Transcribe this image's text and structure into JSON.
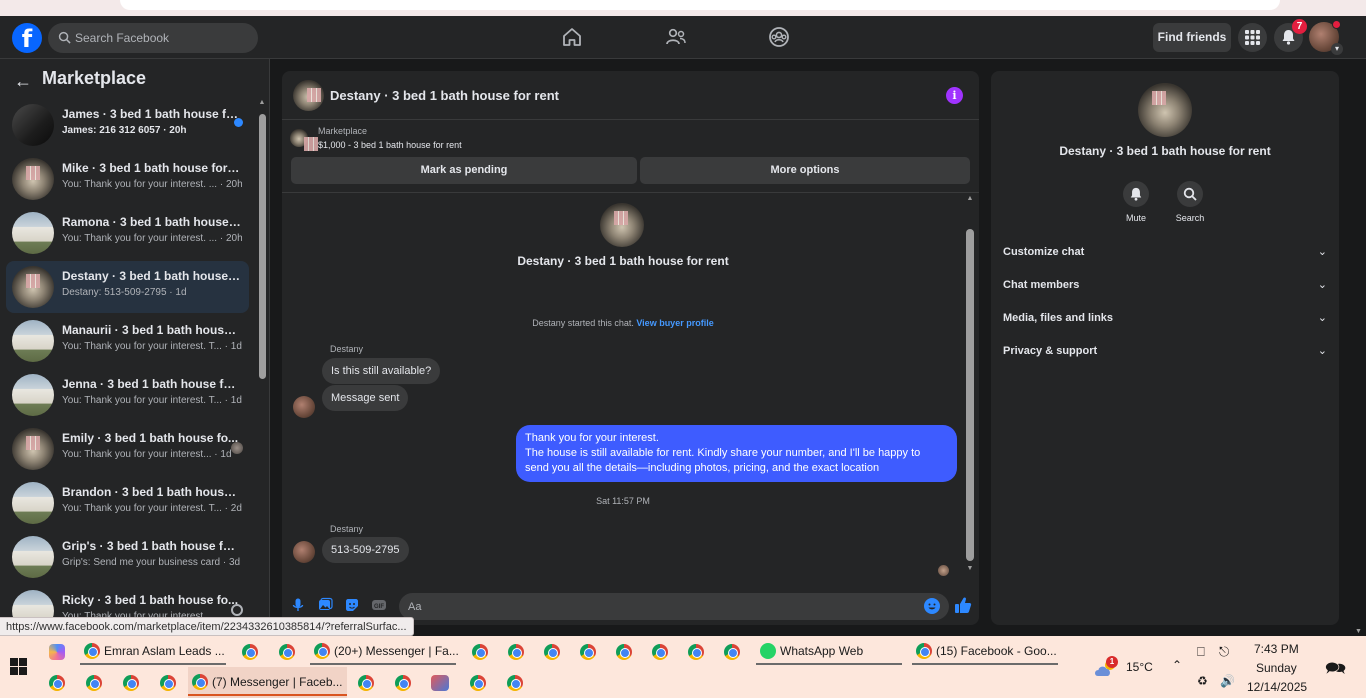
{
  "browser": {
    "status_url": "https://www.facebook.com/marketplace/item/2234332610385814/?referralSurfac..."
  },
  "topbar": {
    "logo": "f",
    "search_placeholder": "Search Facebook",
    "find_friends_label": "Find friends",
    "notifications_count": "7",
    "icons": [
      "home-icon",
      "friends-icon",
      "groups-icon",
      "apps-grid-icon",
      "bell-icon"
    ]
  },
  "sidebar": {
    "title": "Marketplace",
    "conversations": [
      {
        "name": "James · 3 bed 1 bath house fo...",
        "preview": "James: 216 312 6057 · 20h",
        "thumb": "dark",
        "status": "unread",
        "bold": true
      },
      {
        "name": "Mike · 3 bed 1 bath house for re...",
        "preview": "You: Thank you for your interest. ... · 20h",
        "thumb": "room",
        "status": "none"
      },
      {
        "name": "Ramona · 3 bed 1 bath house fo...",
        "preview": "You: Thank you for your interest. ... · 20h",
        "thumb": "house",
        "status": "none"
      },
      {
        "name": "Destany · 3 bed 1 bath house fo...",
        "preview": "Destany: 513-509-2795 · 1d",
        "thumb": "room",
        "status": "none",
        "active": true
      },
      {
        "name": "Manaurii · 3 bed 1 bath house f...",
        "preview": "You: Thank you for your interest. T... · 1d",
        "thumb": "house",
        "status": "none"
      },
      {
        "name": "Jenna · 3 bed 1 bath house for r...",
        "preview": "You: Thank you for your interest. T... · 1d",
        "thumb": "house",
        "status": "none"
      },
      {
        "name": "Emily · 3 bed 1 bath house fo...",
        "preview": "You: Thank you for your interest... · 1d",
        "thumb": "room",
        "status": "seen"
      },
      {
        "name": "Brandon · 3 bed 1 bath house f...",
        "preview": "You: Thank you for your interest. T... · 2d",
        "thumb": "house",
        "status": "none"
      },
      {
        "name": "Grip's · 3 bed 1 bath house for r...",
        "preview": "Grip's: Send me your business card · 3d",
        "thumb": "house",
        "status": "none"
      },
      {
        "name": "Ricky · 3 bed 1 bath house fo...",
        "preview": "You: Thank you for your interest...",
        "thumb": "house",
        "status": "sending"
      }
    ]
  },
  "chat": {
    "title": "Destany · 3 bed 1 bath house for rent",
    "listing_source": "Marketplace",
    "listing_price": "$1,000 - 3 bed 1 bath house for rent",
    "mark_pending_label": "Mark as pending",
    "more_options_label": "More options",
    "center_title": "Destany · 3 bed 1 bath house for rent",
    "started_text": "Destany started this chat. ",
    "view_buyer_profile": "View buyer profile",
    "sender_name": "Destany",
    "msg1": "Is this still available?",
    "msg2": "Message sent",
    "outgoing_lines": [
      "Thank you for your interest.",
      "The house is still available for rent. Kindly share your number, and I'll be happy to",
      "send you all the details—including photos, pricing, and the exact location"
    ],
    "timestamp": "Sat 11:57 PM",
    "sender_name2": "Destany",
    "msg3": "513-509-2795",
    "composer_placeholder": "Aa"
  },
  "details": {
    "title": "Destany · 3 bed 1 bath house for rent",
    "mute_label": "Mute",
    "search_label": "Search",
    "sections": [
      "Customize chat",
      "Chat members",
      "Media, files and links",
      "Privacy & support"
    ]
  },
  "taskbar": {
    "row1_apps": [
      {
        "label": "Emran Aslam Leads ...",
        "kind": "chrome"
      },
      {
        "label": "(20+) Messenger | Fa...",
        "kind": "chrome"
      },
      {
        "label": "WhatsApp Web",
        "kind": "whatsapp"
      },
      {
        "label": "(15) Facebook - Goo...",
        "kind": "chrome"
      }
    ],
    "row2_active": "(7) Messenger | Faceb...",
    "temperature": "15°C",
    "weather_badge": "1",
    "time": "7:43 PM",
    "day": "Sunday",
    "date": "12/14/2025"
  },
  "colors": {
    "accent": "#0866ff",
    "outgoing_bubble": "#3e5cff",
    "info_purple": "#a033ff",
    "badge_red": "#e41e3f"
  }
}
